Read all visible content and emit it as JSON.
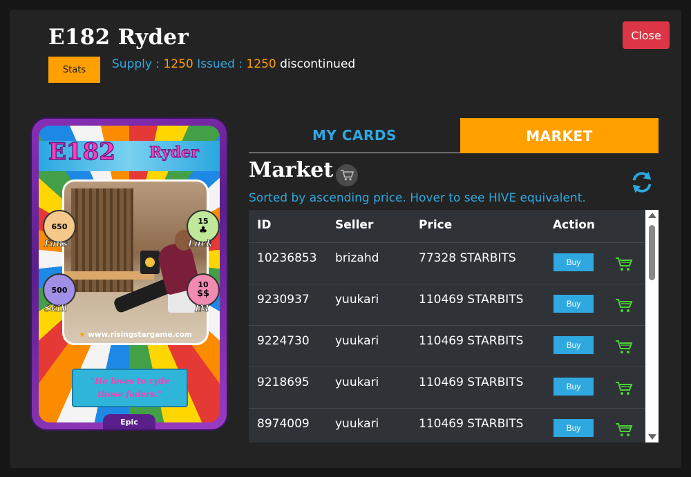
{
  "header": {
    "title": "E182 Ryder",
    "close_label": "Close",
    "stats_label": "Stats",
    "supply_label": "Supply :",
    "supply_value": "1250",
    "issued_label": "Issued :",
    "issued_value": "1250",
    "status": "discontinued"
  },
  "card": {
    "code": "E182",
    "name": "Ryder",
    "fans": "650",
    "fans_label": "Fans",
    "luck": "15",
    "luck_label": "Luck",
    "skill": "500",
    "skill_label": "Skill",
    "im": "10",
    "im_label": "IM",
    "website": "www.risingstargame.com",
    "quote": "\"He loves to ryde\nthose faders.\"",
    "rarity": "Epic"
  },
  "tabs": [
    {
      "label": "MY CARDS",
      "active": false
    },
    {
      "label": "MARKET",
      "active": true
    }
  ],
  "market": {
    "title": "Market",
    "sort_note": "Sorted by ascending price. Hover to see HIVE equivalent.",
    "columns": [
      "ID",
      "Seller",
      "Price",
      "Action"
    ],
    "buy_label": "Buy",
    "rows": [
      {
        "id": "10236853",
        "seller": "brizahd",
        "price": "77328 STARBITS"
      },
      {
        "id": "9230937",
        "seller": "yuukari",
        "price": "110469 STARBITS"
      },
      {
        "id": "9224730",
        "seller": "yuukari",
        "price": "110469 STARBITS"
      },
      {
        "id": "9218695",
        "seller": "yuukari",
        "price": "110469 STARBITS"
      },
      {
        "id": "8974009",
        "seller": "yuukari",
        "price": "110469 STARBITS"
      }
    ]
  },
  "colors": {
    "accent_orange": "#ffa000",
    "accent_blue": "#2fa8e0",
    "close_red": "#dc3545",
    "cart_green": "#4cd137"
  },
  "icons": [
    "shopping-cart-icon",
    "refresh-icon",
    "clover-icon",
    "money-icon",
    "star-icon"
  ]
}
